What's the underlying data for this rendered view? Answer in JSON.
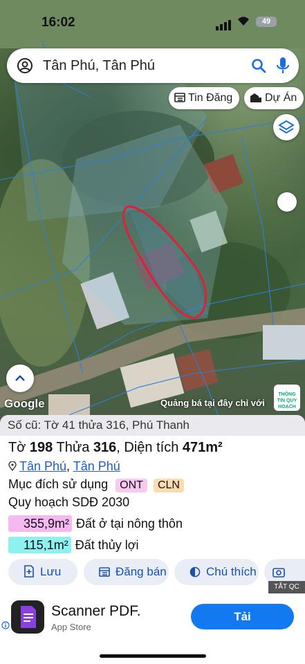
{
  "status_bar": {
    "time": "16:02",
    "battery": "49"
  },
  "search": {
    "query": "Tân Phú, Tân Phú"
  },
  "map_chips": {
    "listing": "Tin Đăng",
    "project": "Dự Án"
  },
  "map": {
    "google_logo": "Google",
    "promo_text": "Quảng bá tại đây chỉ với",
    "badge_text": "THÔNG TIN QUY HOẠCH"
  },
  "parcel": {
    "old_number": "Số cũ: Tờ 41 thửa 316, Phú Thanh",
    "sheet_label": "Tờ",
    "sheet": "198",
    "plot_label": "Thửa",
    "plot": "316",
    "area_label": ", Diện tích",
    "area": "471m²",
    "location_1": "Tân Phú",
    "location_sep": ", ",
    "location_2": "Tân Phú",
    "purpose_label": "Mục đích sử dụng",
    "purpose_tags": [
      "ONT",
      "CLN"
    ],
    "plan": "Quy hoạch SDĐ 2030",
    "areas": [
      {
        "value": "355,9m²",
        "label": "Đất ở tại nông thôn",
        "color": "#f6b8f0"
      },
      {
        "value": "115,1m²",
        "label": "Đất thủy lợi",
        "color": "#8ff0f0"
      }
    ]
  },
  "actions": {
    "save": "Lưu",
    "post": "Đăng bán",
    "legend": "Chú thích",
    "capture": "Ch"
  },
  "ad": {
    "close_label": "TẮT QC",
    "title": "Scanner PDF.",
    "store": "App Store",
    "install": "Tải"
  }
}
